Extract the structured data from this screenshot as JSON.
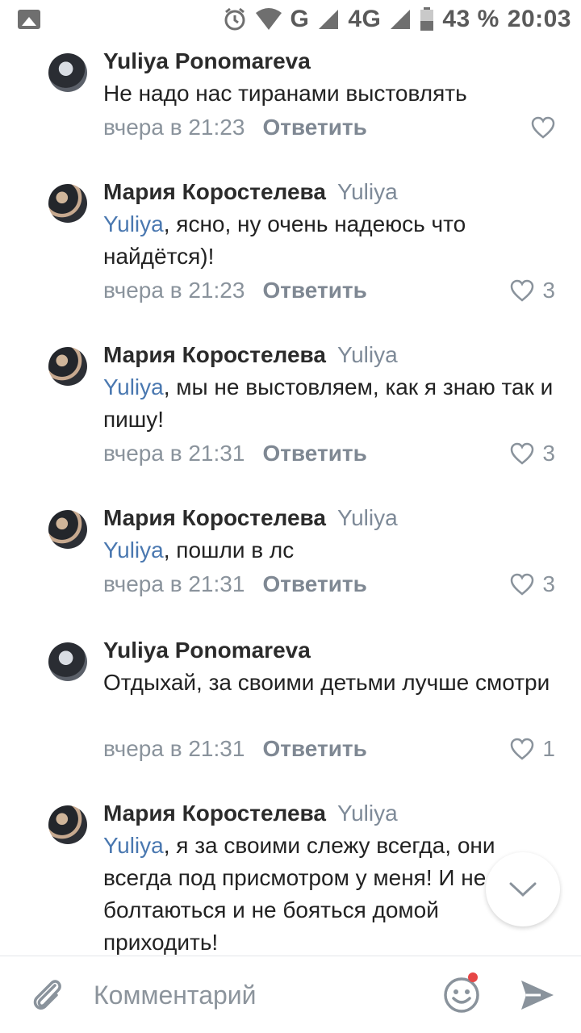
{
  "status_bar": {
    "battery": "43 %",
    "time": "20:03",
    "network": "G",
    "network2": "4G"
  },
  "comments": [
    {
      "author": "Yuliya Ponomareva",
      "reply_to": "",
      "mention": "",
      "text": "Не надо нас тиранами выстовлять",
      "time": "вчера в 21:23",
      "reply_label": "Ответить",
      "likes": ""
    },
    {
      "author": "Мария Коростелева",
      "reply_to": "Yuliya",
      "mention": "Yuliya",
      "text": ", ясно, ну очень надеюсь что найдётся)!",
      "time": "вчера в 21:23",
      "reply_label": "Ответить",
      "likes": "3"
    },
    {
      "author": "Мария Коростелева",
      "reply_to": "Yuliya",
      "mention": "Yuliya",
      "text": ", мы не выстовляем, как я знаю так и пишу!",
      "time": "вчера в 21:31",
      "reply_label": "Ответить",
      "likes": "3"
    },
    {
      "author": "Мария Коростелева",
      "reply_to": "Yuliya",
      "mention": "Yuliya",
      "text": ", пошли в лс",
      "time": "вчера в 21:31",
      "reply_label": "Ответить",
      "likes": "3"
    },
    {
      "author": "Yuliya Ponomareva",
      "reply_to": "",
      "mention": "",
      "text": "Отдыхай, за своими детьми лучше смотри",
      "time": "вчера в 21:31",
      "reply_label": "Ответить",
      "likes": "1"
    },
    {
      "author": "Мария Коростелева",
      "reply_to": "Yuliya",
      "mention": "Yuliya",
      "text": ", я за своими слежу всегда, они всегда под присмотром у меня! И не болтаються и не бояться домой приходить!",
      "time": "",
      "reply_label": "",
      "likes": ""
    }
  ],
  "input": {
    "placeholder": "Комментарий"
  },
  "icons": {
    "attach": "paperclip-icon",
    "emoji": "smiley-icon",
    "send": "send-icon",
    "scroll_down": "chevron-down-icon"
  },
  "colors": {
    "mention": "#4a78b0",
    "meta": "#8a939c",
    "notification_dot": "#e64646"
  }
}
